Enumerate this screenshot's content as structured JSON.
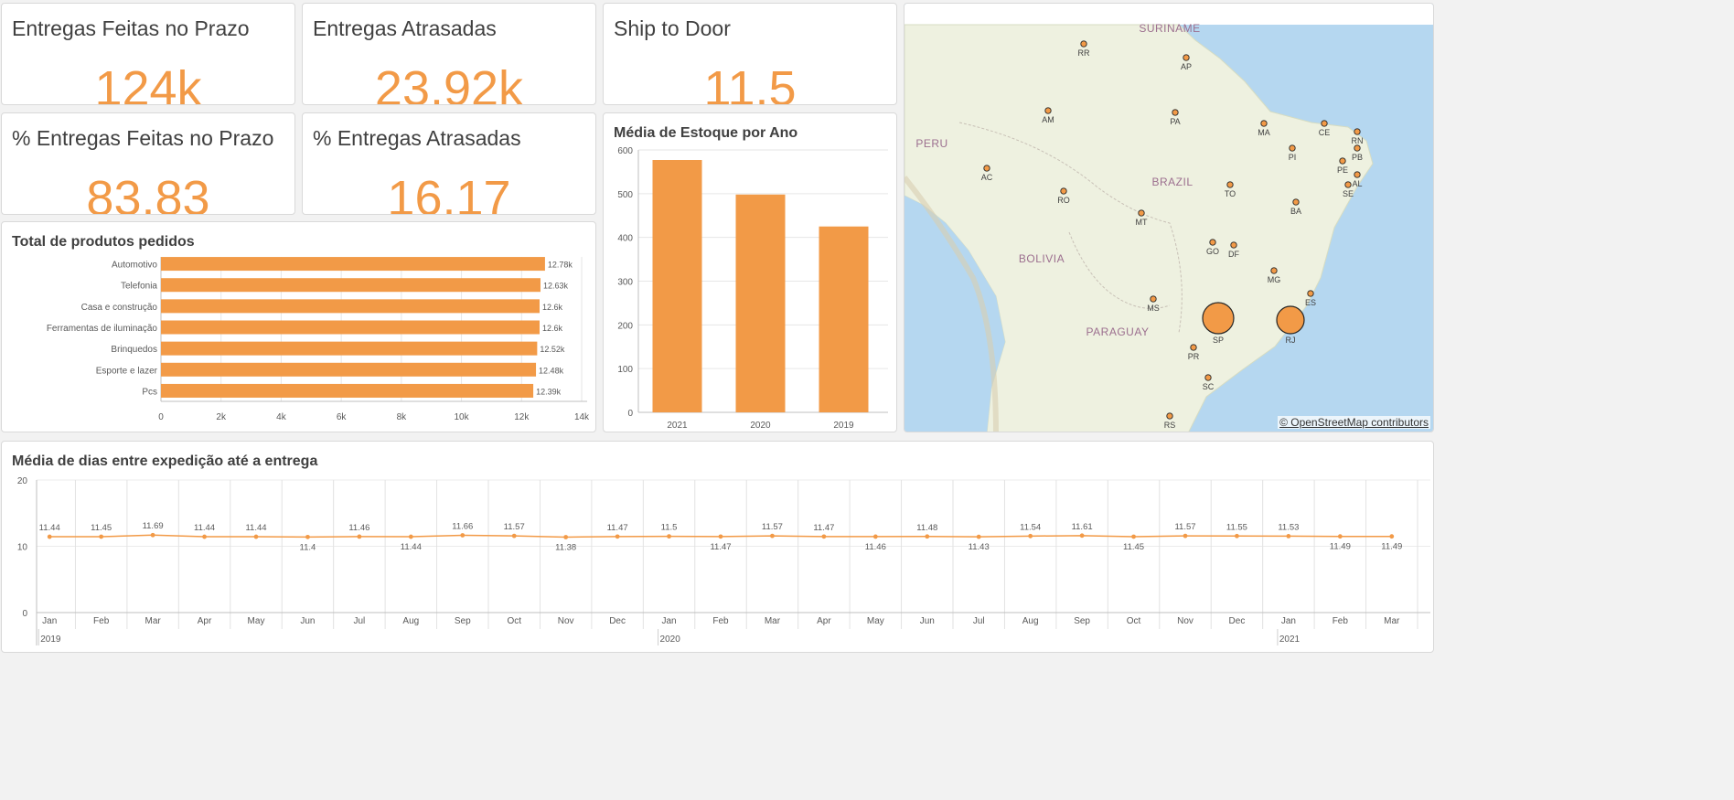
{
  "kpis": {
    "on_time": {
      "title": "Entregas Feitas no Prazo",
      "value": "124k"
    },
    "late": {
      "title": "Entregas Atrasadas",
      "value": "23.92k"
    },
    "ship_to_door": {
      "title": "Ship to Door",
      "value": "11.5"
    },
    "on_time_pct": {
      "title": "% Entregas Feitas no Prazo",
      "value": "83.83"
    },
    "late_pct": {
      "title": "% Entregas Atrasadas",
      "value": "16.17"
    }
  },
  "colors": {
    "accent": "#f29a47",
    "card": "#ffffff",
    "background": "#f2f2f2",
    "water": "#b5d7f0",
    "land": "#eef1e0"
  },
  "chart_data": [
    {
      "type": "bar",
      "orientation": "horizontal",
      "title": "Total de produtos pedidos",
      "categories": [
        "Automotivo",
        "Telefonia",
        "Casa e construção",
        "Ferramentas de iluminação",
        "Brinquedos",
        "Esporte e lazer",
        "Pcs"
      ],
      "values": [
        12780,
        12630,
        12600,
        12600,
        12520,
        12480,
        12390
      ],
      "data_labels": [
        "12.78k",
        "12.63k",
        "12.6k",
        "12.6k",
        "12.52k",
        "12.48k",
        "12.39k"
      ],
      "xlim": [
        0,
        14000
      ],
      "x_ticks": [
        0,
        2000,
        4000,
        6000,
        8000,
        10000,
        12000,
        14000
      ],
      "x_tick_labels": [
        "0",
        "2k",
        "4k",
        "6k",
        "8k",
        "10k",
        "12k",
        "14k"
      ],
      "grid": true
    },
    {
      "type": "bar",
      "title": "Média de Estoque por Ano",
      "categories": [
        "2021",
        "2020",
        "2019"
      ],
      "values": [
        577,
        498,
        425
      ],
      "ylim": [
        0,
        600
      ],
      "y_ticks": [
        0,
        100,
        200,
        300,
        400,
        500,
        600
      ],
      "grid": true
    },
    {
      "type": "line",
      "title": "Média de dias entre expedição até a entrega",
      "x": [
        "Jan",
        "Feb",
        "Mar",
        "Apr",
        "May",
        "Jun",
        "Jul",
        "Aug",
        "Sep",
        "Oct",
        "Nov",
        "Dec",
        "Jan",
        "Feb",
        "Mar",
        "Apr",
        "May",
        "Jun",
        "Jul",
        "Aug",
        "Sep",
        "Oct",
        "Nov",
        "Dec",
        "Jan",
        "Feb",
        "Mar"
      ],
      "year_labels": [
        "2019",
        "2020",
        "2021"
      ],
      "values": [
        11.44,
        11.45,
        11.69,
        11.44,
        11.44,
        11.4,
        11.46,
        11.44,
        11.66,
        11.57,
        11.38,
        11.47,
        11.5,
        11.47,
        11.57,
        11.47,
        11.46,
        11.48,
        11.43,
        11.54,
        11.61,
        11.45,
        11.57,
        11.55,
        11.53,
        11.49,
        11.49
      ],
      "data_labels": [
        "11.44",
        "11.45",
        "11.69",
        "11.44",
        "11.44",
        "11.4",
        "11.46",
        "11.44",
        "11.66",
        "11.57",
        "11.38",
        "11.47",
        "11.5",
        "11.47",
        "11.57",
        "11.47",
        "11.46",
        "11.48",
        "11.43",
        "11.54",
        "11.61",
        "11.45",
        "11.57",
        "11.55",
        "11.53",
        "11.49",
        "11.49"
      ],
      "ylim": [
        0,
        20
      ],
      "y_ticks": [
        0,
        10,
        20
      ],
      "grid": true
    }
  ],
  "map": {
    "country_labels": [
      "SURINAME",
      "PERU",
      "BRAZIL",
      "BOLIVIA",
      "PARAGUAY"
    ],
    "states": [
      "RR",
      "AP",
      "AM",
      "PA",
      "MA",
      "CE",
      "RN",
      "PB",
      "PI",
      "PE",
      "AL",
      "SE",
      "AC",
      "RO",
      "TO",
      "BA",
      "MT",
      "GO",
      "DF",
      "MG",
      "ES",
      "MS",
      "SP",
      "RJ",
      "PR",
      "SC",
      "RS"
    ],
    "attribution": "© OpenStreetMap contributors"
  }
}
